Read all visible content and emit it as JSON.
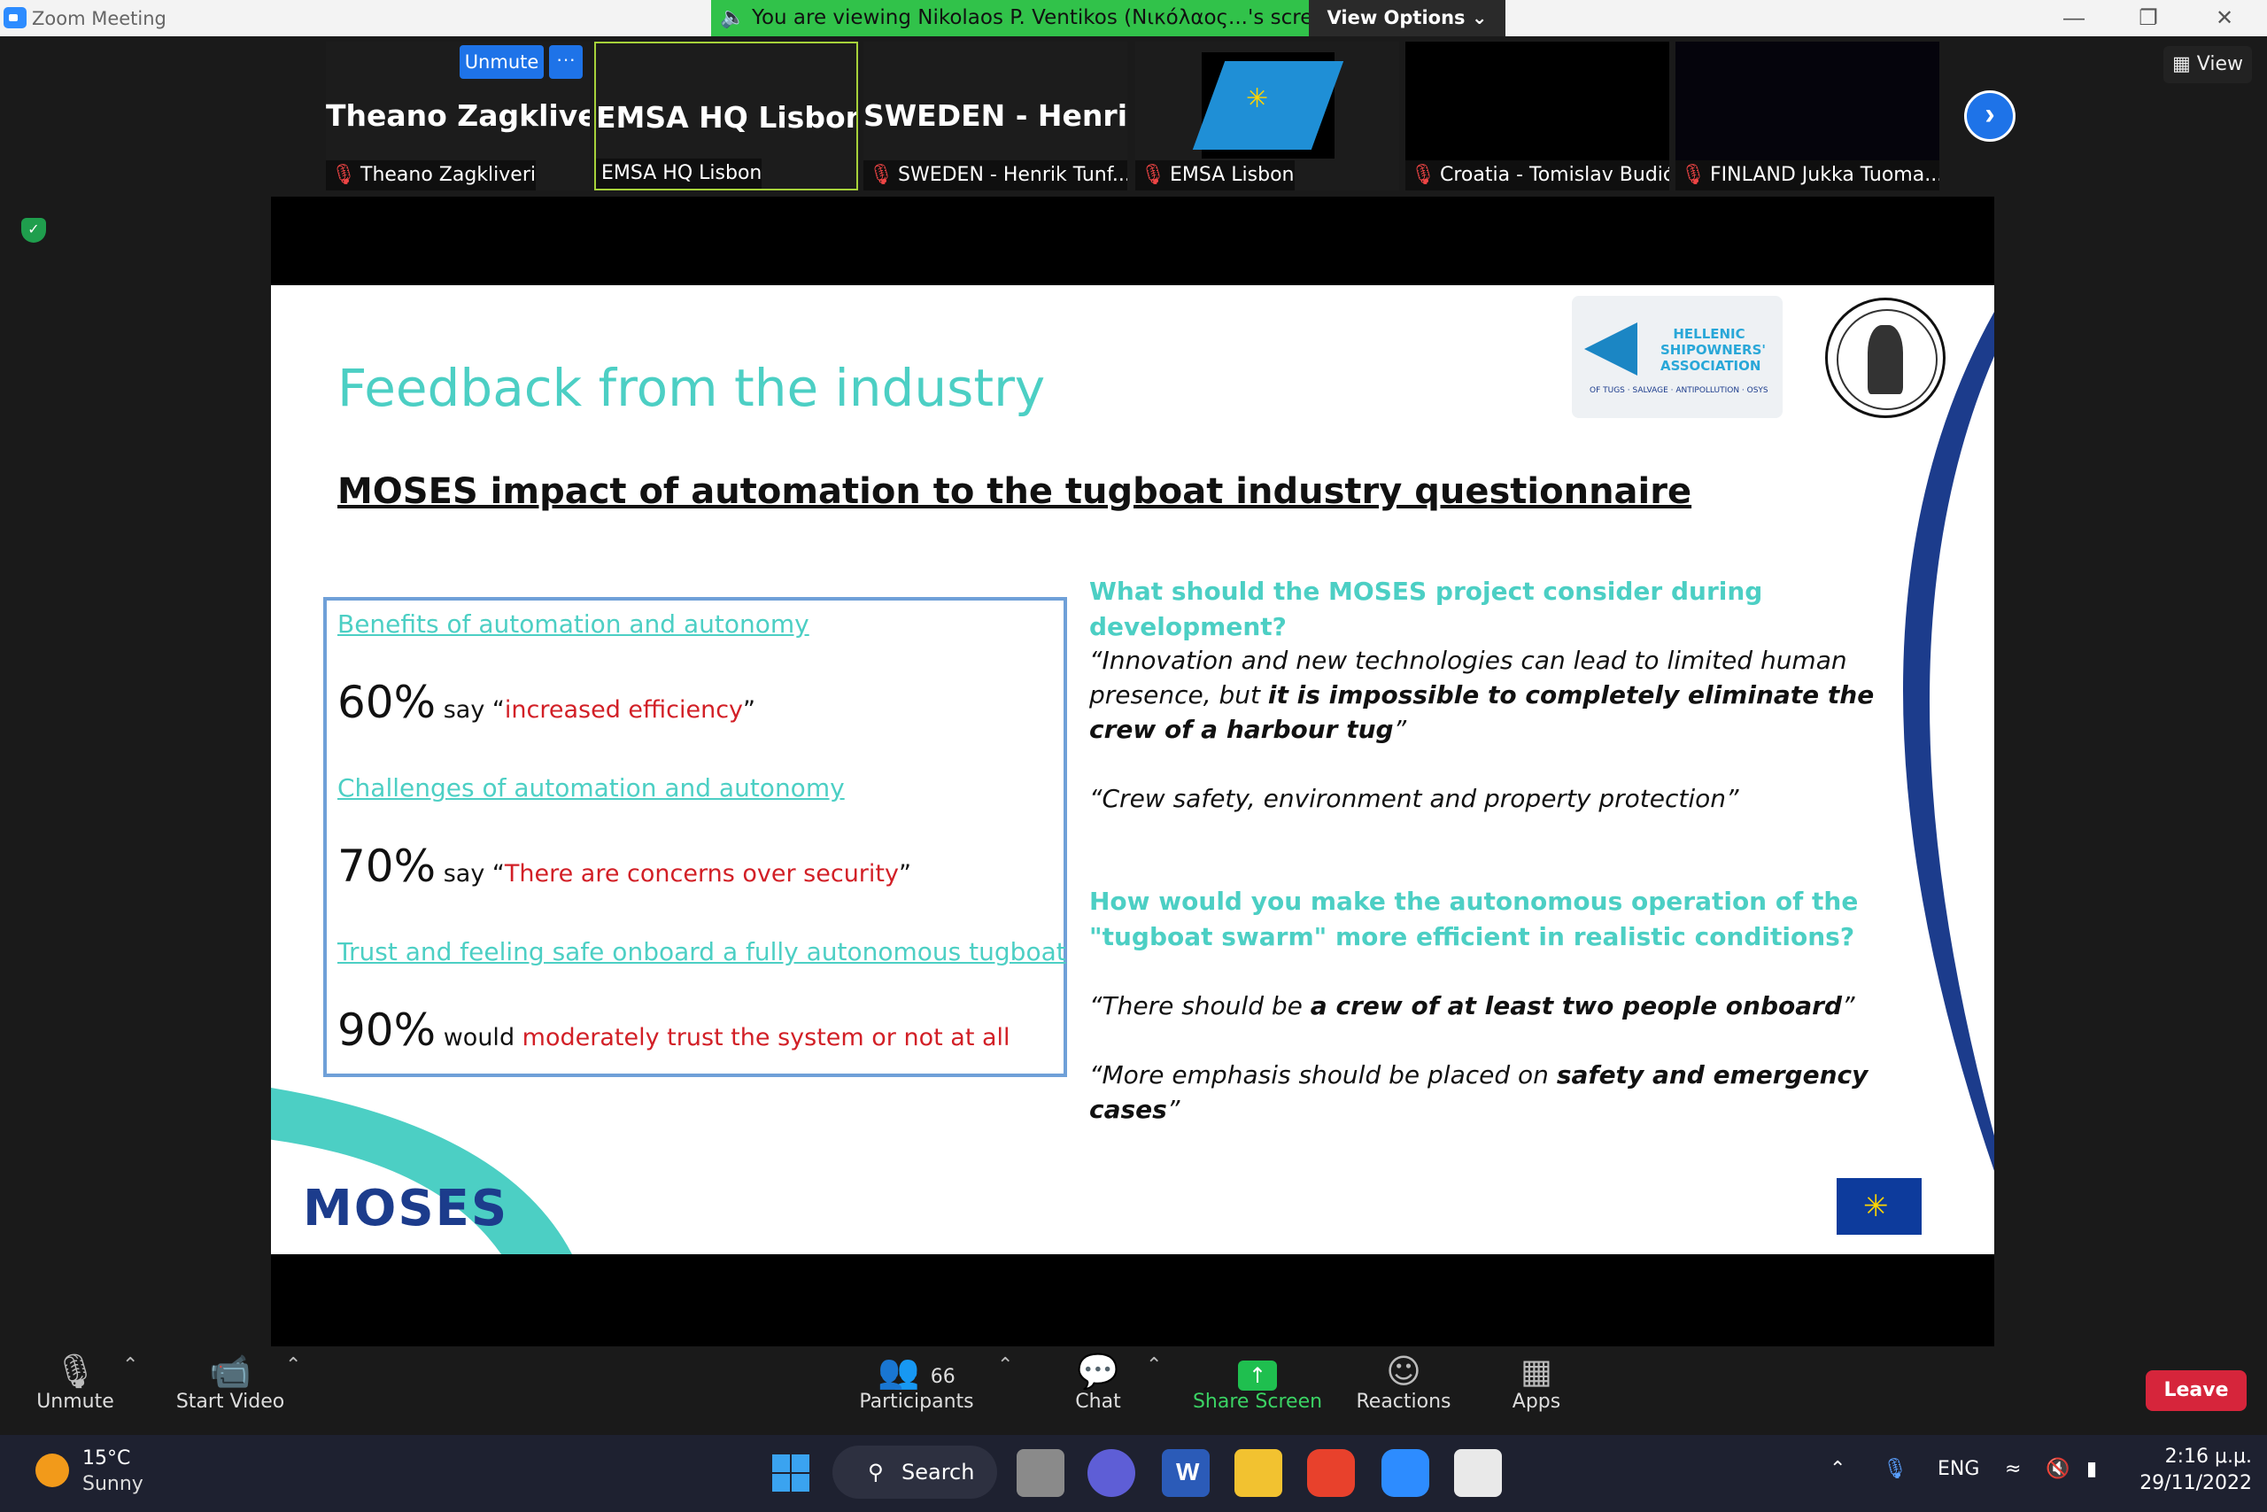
{
  "window": {
    "title": "Zoom Meeting",
    "share_banner": "You are viewing Nikolaos P. Ventikos (Νικόλαος...'s screen",
    "view_options": "View Options"
  },
  "participants_strip": {
    "unmute_label": "Unmute",
    "more_label": "···",
    "view_label": "View",
    "tiles": [
      {
        "big_name": "Theano Zagkliveri",
        "label": "Theano Zagkliveri",
        "muted": true
      },
      {
        "big_name": "EMSA HQ Lisbon",
        "label": "EMSA HQ Lisbon",
        "muted": false
      },
      {
        "big_name": "SWEDEN  -  Henri...",
        "label": "SWEDEN - Henrik Tunf...",
        "muted": true
      },
      {
        "big_name": "",
        "label": "EMSA Lisbon",
        "muted": true
      },
      {
        "big_name": "",
        "label": "Croatia - Tomislav Budić",
        "muted": true
      },
      {
        "big_name": "",
        "label": "FINLAND Jukka Tuoma...",
        "muted": true
      }
    ]
  },
  "slide": {
    "title": "Feedback from the industry",
    "subtitle": "MOSES impact of automation to the tugboat industry questionnaire",
    "box": {
      "h1": "Benefits of automation and autonomy",
      "s1_pct": "60%",
      "s1_mid": " say “",
      "s1_red": "increased efficiency",
      "s1_end": "”",
      "h2": "Challenges of automation and autonomy",
      "s2_pct": "70%",
      "s2_mid": " say “",
      "s2_red": "There are concerns over security",
      "s2_end": "”",
      "h3": "Trust and feeling safe onboard a fully autonomous tugboat",
      "s3_pct": "90%",
      "s3_mid": " would ",
      "s3_red": "moderately trust the system or not at all"
    },
    "q1": "What should the MOSES project consider during development?",
    "quote1_a": "“Innovation and new technologies can lead to limited human presence, but ",
    "quote1_b": "it is impossible to completely eliminate the crew of a harbour tug",
    "quote1_c": "”",
    "quote2": "“Crew safety, environment and property protection”",
    "q2": "How would you make the autonomous operation of the \"tugboat swarm\" more efficient in realistic conditions?",
    "quote3_a": "“There should be ",
    "quote3_b": "a crew of at least two people onboard",
    "quote3_c": "”",
    "quote4_a": "“More emphasis should be placed on ",
    "quote4_b": "safety and emergency cases",
    "quote4_c": "”",
    "hsa_logo_text": "HELLENIC SHIPOWNERS' ASSOCIATION",
    "hsa_logo_small": "OF TUGS · SALVAGE · ANTIPOLLUTION · OSYS",
    "moses_logo": "MOSES"
  },
  "toolbar": {
    "unmute": "Unmute",
    "start_video": "Start Video",
    "participants": "Participants",
    "participants_count": "66",
    "chat": "Chat",
    "share_screen": "Share Screen",
    "reactions": "Reactions",
    "apps": "Apps",
    "leave": "Leave"
  },
  "taskbar": {
    "temp": "15°C",
    "condition": "Sunny",
    "search": "Search",
    "lang": "ENG",
    "time": "2:16 μ.μ.",
    "date": "29/11/2022"
  },
  "colors": {
    "accent_teal": "#4ccfc4",
    "stat_red": "#d21f26",
    "zoom_blue": "#1e73e8",
    "share_green": "#31c24a",
    "leave_red": "#d6253b"
  }
}
